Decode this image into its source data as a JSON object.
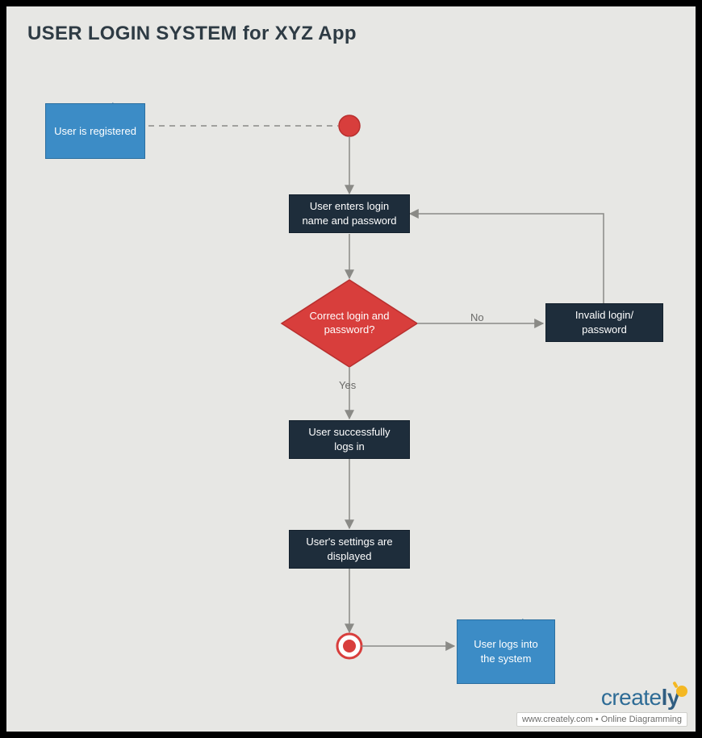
{
  "title": "USER LOGIN SYSTEM for XYZ App",
  "notes": {
    "start": "User is registered",
    "end": "User logs into the system"
  },
  "nodes": {
    "enter": "User enters login name and password",
    "decision": "Correct login and password?",
    "invalid": "Invalid login/ password",
    "success": "User successfully logs in",
    "settings": "User's settings are displayed"
  },
  "edges": {
    "yes": "Yes",
    "no": "No"
  },
  "branding": {
    "name_a": "create",
    "name_b": "ly",
    "tagline": "www.creately.com • Online Diagramming"
  },
  "colors": {
    "bg": "#E7E7E4",
    "dark": "#1E2D3B",
    "red": "#D83E3C",
    "blue": "#3C8CC6",
    "line": "#8A8A86"
  }
}
